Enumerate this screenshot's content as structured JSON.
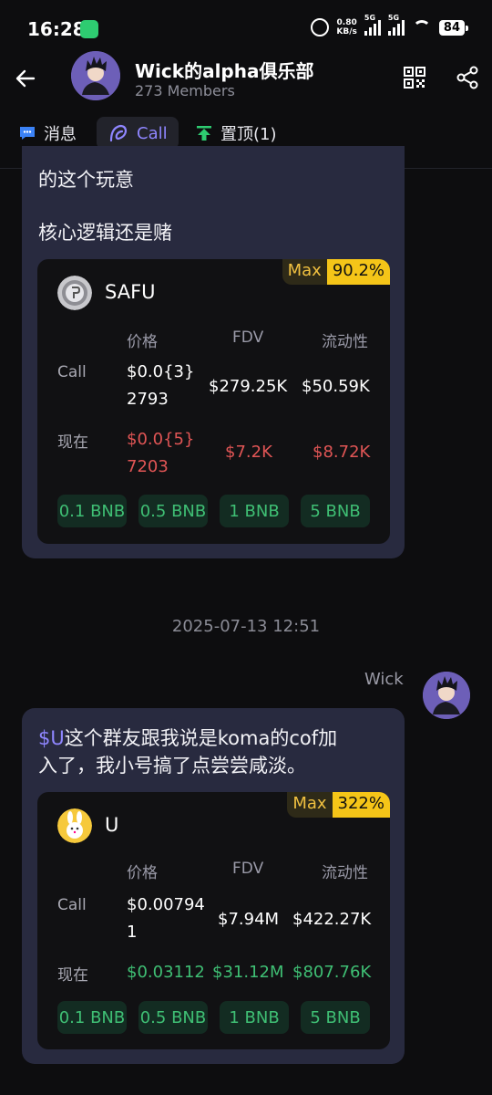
{
  "status_bar": {
    "time": "16:28",
    "net_speed_value": "0.80",
    "net_speed_unit": "KB/s",
    "sim1": "5G",
    "sim2": "5G",
    "battery": "84"
  },
  "header": {
    "title": "Wick的alpha俱乐部",
    "members": "273 Members"
  },
  "tabs": [
    {
      "label": "消息",
      "icon": "message-icon"
    },
    {
      "label": "Call",
      "icon": "call-icon",
      "active": true
    },
    {
      "label": "置顶(1)",
      "icon": "pin-top-icon"
    }
  ],
  "messages": [
    {
      "lines": [
        "的这个玩意",
        "核心逻辑还是赌"
      ],
      "card": {
        "token": "SAFU",
        "max_label": "Max",
        "max_value": "90.2%",
        "headers": [
          "价格",
          "FDV",
          "流动性"
        ],
        "call_label": "Call",
        "call_price_1": "$0.0{3}",
        "call_price_2": "2793",
        "call_fdv": "$279.25K",
        "call_liq": "$50.59K",
        "now_label": "现在",
        "now_price_1": "$0.0{5}",
        "now_price_2": "7203",
        "now_fdv": "$7.2K",
        "now_liq": "$8.72K",
        "now_color": "#e05555",
        "buttons": [
          "0.1 BNB",
          "0.5 BNB",
          "1 BNB",
          "5 BNB"
        ]
      }
    },
    {
      "timestamp": "2025-07-13 12:51",
      "sender": "Wick",
      "ticker": "$U",
      "text_1": "这个群友跟我说是koma的cof加",
      "text_2": "入了，我小号搞了点尝尝咸淡。",
      "card": {
        "token": "U",
        "max_label": "Max",
        "max_value": "322%",
        "headers": [
          "价格",
          "FDV",
          "流动性"
        ],
        "call_label": "Call",
        "call_price_1": "$0.00794",
        "call_price_2": "1",
        "call_fdv": "$7.94M",
        "call_liq": "$422.27K",
        "now_label": "现在",
        "now_price": "$0.03112",
        "now_fdv": "$31.12M",
        "now_liq": "$807.76K",
        "now_color": "#3fbf74",
        "buttons": [
          "0.1 BNB",
          "0.5 BNB",
          "1 BNB",
          "5 BNB"
        ]
      }
    }
  ],
  "colors": {
    "accent": "#8f86ff",
    "badge": "#f5c518",
    "bubble": "#282a3f",
    "positive": "#3fbf74",
    "negative": "#e05555"
  }
}
